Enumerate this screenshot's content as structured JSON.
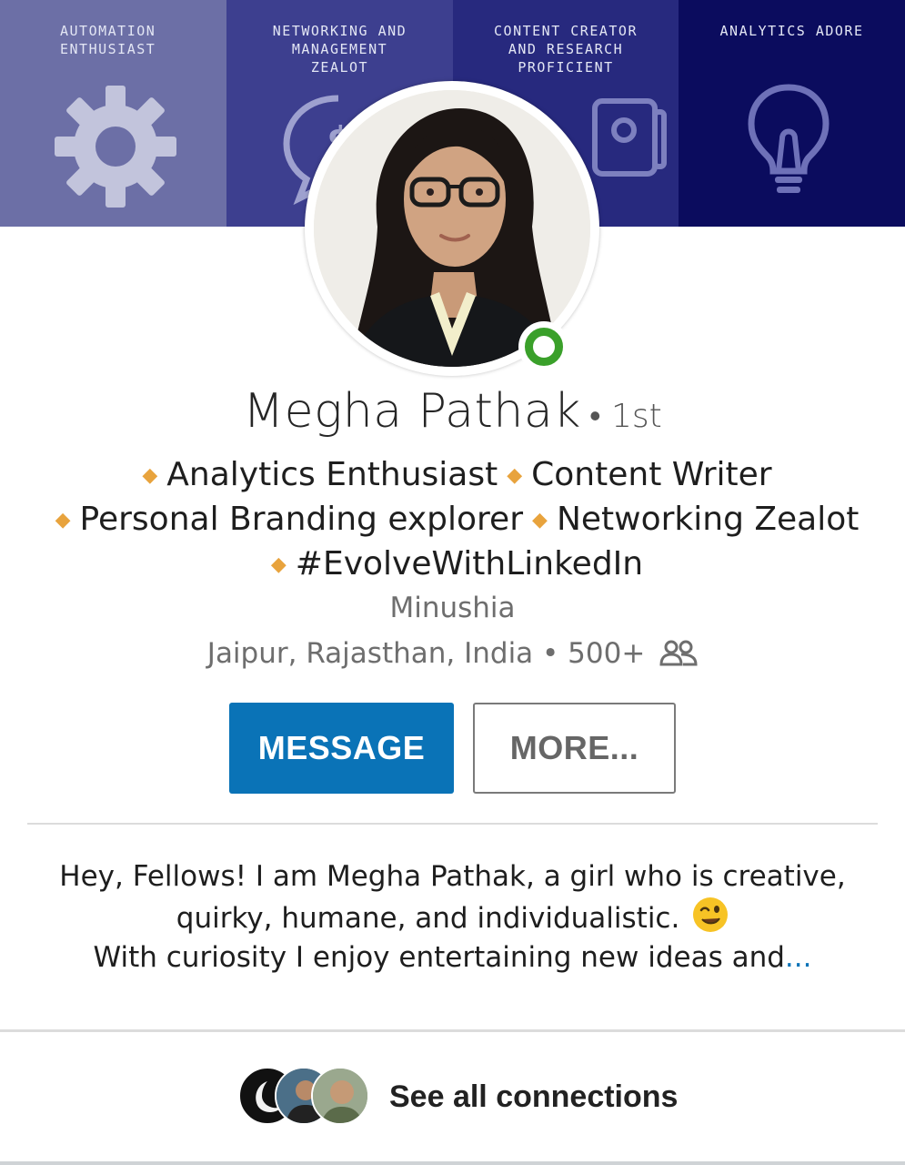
{
  "banner": {
    "panels": [
      {
        "text": "AUTOMATION\nENTHUSIAST",
        "icon": "gear-icon"
      },
      {
        "text": "NETWORKING AND\nMANAGEMENT\nZEALOT",
        "icon": "speech-bubble-icon"
      },
      {
        "text": "CONTENT CREATOR\nAND RESEARCH\nPROFICIENT",
        "icon": "document-icon"
      },
      {
        "text": "ANALYTICS ADORE",
        "icon": "lightbulb-icon"
      }
    ]
  },
  "profile": {
    "name": "Megha Pathak",
    "degree": "• 1st",
    "headline_items": [
      "Analytics Enthusiast",
      "Content Writer",
      "Personal Branding explorer",
      "Networking Zealot",
      "#EvolveWithLinkedIn"
    ],
    "company": "Minushia",
    "location": "Jaipur, Rajasthan, India",
    "connections_count": "• 500+",
    "presence": "online",
    "presence_color": "#3aa02a"
  },
  "actions": {
    "message_label": "MESSAGE",
    "more_label": "MORE..."
  },
  "summary": {
    "line1": "Hey, Fellows! I am Megha Pathak, a girl who is creative,",
    "line2": "quirky, humane, and individualistic.",
    "line3": "With curiosity I enjoy entertaining new ideas and",
    "ellipsis": "..."
  },
  "connections": {
    "label": "See all connections"
  },
  "colors": {
    "accent": "#0a73b7",
    "diamond": "#e8a33d"
  }
}
